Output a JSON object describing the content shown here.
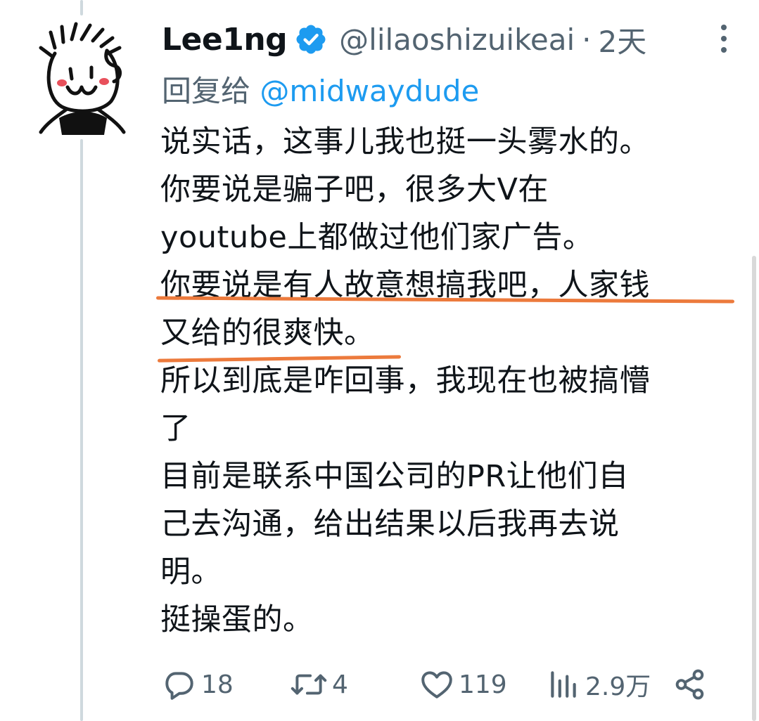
{
  "tweet": {
    "display_name": "Lee1ng",
    "handle": "@lilaoshizuikeai",
    "separator": "·",
    "time": "2天",
    "reply_to_label": "回复给",
    "reply_to_handle": "@midwaydude",
    "lines": [
      "说实话，这事儿我也挺一头雾水的。",
      "你要说是骗子吧，很多大V在",
      "youtube上都做过他们家广告。",
      "你要说是有人故意想搞我吧，人家钱",
      "又给的很爽快。",
      "所以到底是咋回事，我现在也被搞懵",
      "了",
      "目前是联系中国公司的PR让他们自",
      "己去沟通，给出结果以后我再去说",
      "明。",
      "挺操蛋的。"
    ],
    "highlight_color": "#ec7a3c",
    "verified_color": "#1d9bf0"
  },
  "actions": {
    "replies": "18",
    "retweets": "4",
    "likes": "119",
    "views": "2.9万"
  },
  "icons": [
    "more-vertical-icon",
    "verified-badge-icon",
    "reply-icon",
    "retweet-icon",
    "like-icon",
    "views-icon",
    "share-icon"
  ]
}
